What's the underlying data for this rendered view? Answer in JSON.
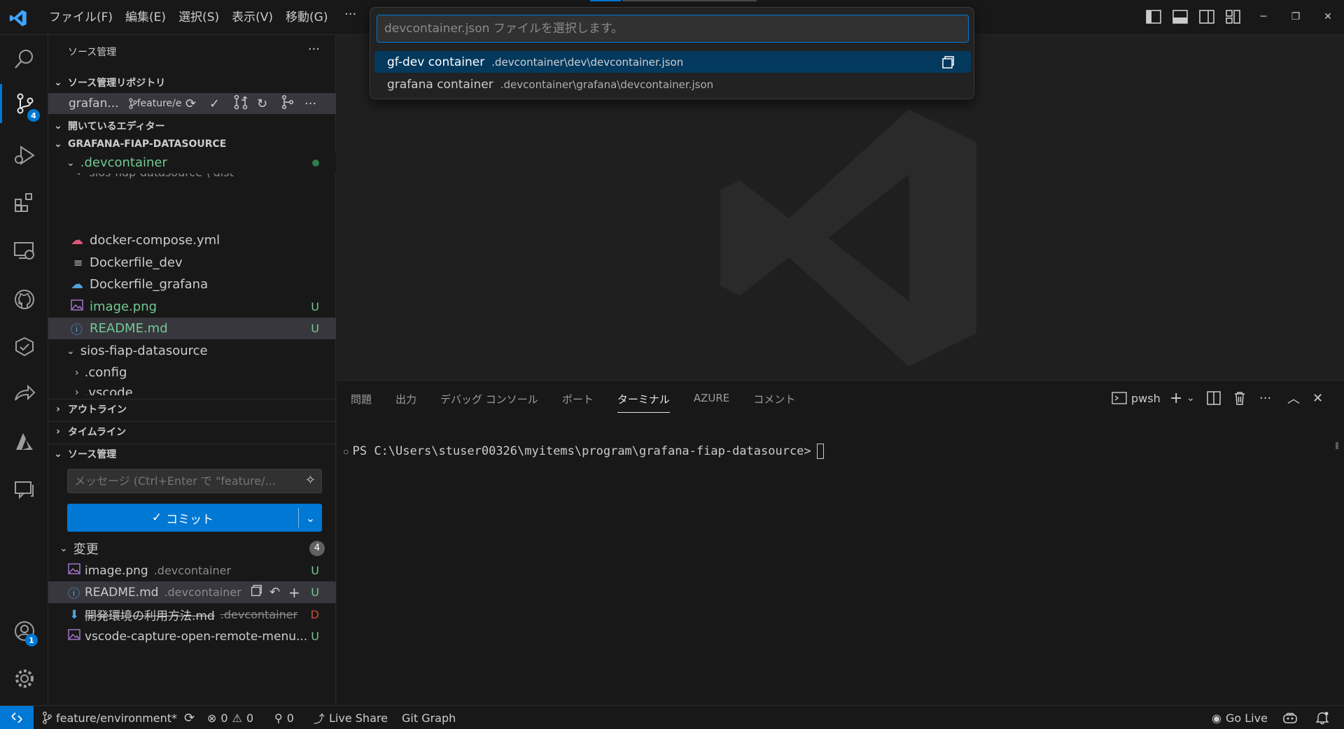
{
  "menu": [
    "ファイル(F)",
    "編集(E)",
    "選択(S)",
    "表示(V)",
    "移動(G)"
  ],
  "menu_more": "···",
  "quick_pick": {
    "placeholder": "devcontainer.json ファイルを選択します。",
    "items": [
      {
        "label": "gf-dev container",
        "desc": ".devcontainer\\dev\\devcontainer.json"
      },
      {
        "label": "grafana container",
        "desc": ".devcontainer\\grafana\\devcontainer.json"
      }
    ]
  },
  "activity": {
    "scm_badge": "4",
    "accounts_badge": "1"
  },
  "sidebar": {
    "title": "ソース管理",
    "more": "···",
    "repos_header": "ソース管理リポジトリ",
    "repo": {
      "name": "grafan...",
      "branch": "feature/e"
    },
    "open_editors": "開いているエディター",
    "folder": "GRAFANA-FIAP-DATASOURCE",
    "devcontainer": ".devcontainer",
    "partial_top": "sios-fiap-datasource \\ dist",
    "files": [
      {
        "name": "docker-compose.yml",
        "status": ""
      },
      {
        "name": "Dockerfile_dev",
        "status": ""
      },
      {
        "name": "Dockerfile_grafana",
        "status": ""
      },
      {
        "name": "image.png",
        "status": "U"
      },
      {
        "name": "README.md",
        "status": "U"
      }
    ],
    "sios_folder": "sios-fiap-datasource",
    "config": ".config",
    "vscode": ".vscode",
    "outline": "アウトライン",
    "timeline": "タイムライン",
    "scm_section": "ソース管理",
    "message_placeholder": "メッセージ (Ctrl+Enter で \"feature/...",
    "commit_label": "コミット",
    "changes_label": "変更",
    "changes_count": "4",
    "changes": [
      {
        "name": "image.png",
        "dir": ".devcontainer",
        "status": "U"
      },
      {
        "name": "README.md",
        "dir": ".devcontainer",
        "status": "U"
      },
      {
        "name": "開発環境の利用方法.md",
        "dir": ".devcontainer",
        "status": "D"
      },
      {
        "name": "vscode-capture-open-remote-menu...",
        "dir": "",
        "status": "U"
      }
    ]
  },
  "panel": {
    "tabs": [
      "問題",
      "出力",
      "デバッグ コンソール",
      "ポート",
      "ターミナル",
      "AZURE",
      "コメント"
    ],
    "shell": "pwsh",
    "prompt": "PS C:\\Users\\stuser00326\\myitems\\program\\grafana-fiap-datasource>"
  },
  "status": {
    "branch": "feature/environment*",
    "errors": "0",
    "warnings": "0",
    "ports": "0",
    "live_share": "Live Share",
    "git_graph": "Git Graph",
    "go_live": "Go Live"
  },
  "colors": {
    "accent": "#0078d4",
    "added": "#73c991",
    "deleted": "#c74e39"
  }
}
